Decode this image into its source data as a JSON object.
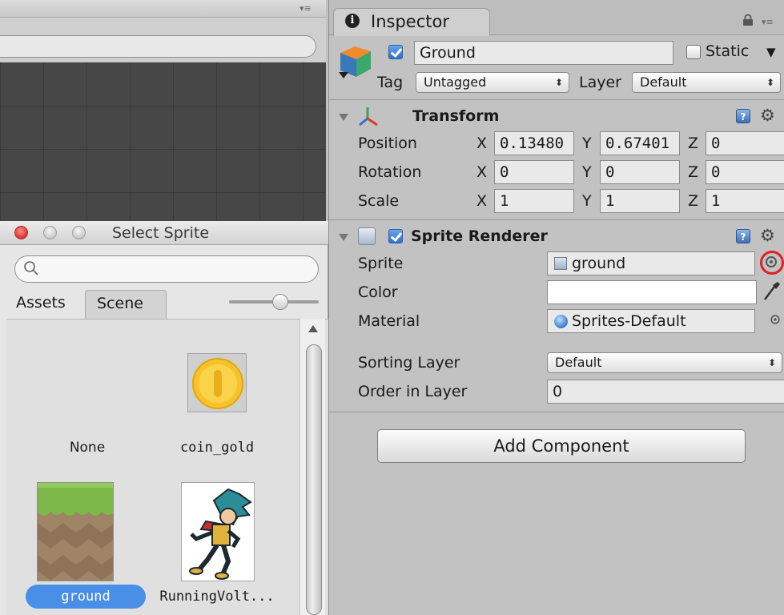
{
  "select_sprite": {
    "title": "Select Sprite",
    "search_placeholder": "",
    "tabs": [
      "Assets",
      "Scene"
    ],
    "active_tab": "Scene",
    "items": [
      {
        "label": "None"
      },
      {
        "label": "coin_gold"
      },
      {
        "label": "ground",
        "selected": true
      },
      {
        "label": "RunningVolt..."
      }
    ]
  },
  "inspector": {
    "tab_label": "Inspector",
    "object": {
      "active": true,
      "name": "Ground",
      "static_label": "Static",
      "static_checked": false,
      "tag_label": "Tag",
      "tag_value": "Untagged",
      "layer_label": "Layer",
      "layer_value": "Default"
    },
    "transform": {
      "title": "Transform",
      "position_label": "Position",
      "rotation_label": "Rotation",
      "scale_label": "Scale",
      "axis_x": "X",
      "axis_y": "Y",
      "axis_z": "Z",
      "position": {
        "x": "0.13480",
        "y": "0.67401",
        "z": "0"
      },
      "rotation": {
        "x": "0",
        "y": "0",
        "z": "0"
      },
      "scale": {
        "x": "1",
        "y": "1",
        "z": "1"
      }
    },
    "sprite_renderer": {
      "title": "Sprite Renderer",
      "enabled": true,
      "sprite_label": "Sprite",
      "sprite_value": "ground",
      "color_label": "Color",
      "color_value": "#ffffff",
      "material_label": "Material",
      "material_value": "Sprites-Default",
      "sorting_layer_label": "Sorting Layer",
      "sorting_layer_value": "Default",
      "order_label": "Order in Layer",
      "order_value": "0"
    },
    "add_component": "Add Component"
  },
  "colors": {
    "panel": "#c2c2c2",
    "selection": "#4a8fe7",
    "highlight_ring": "#e02020"
  }
}
